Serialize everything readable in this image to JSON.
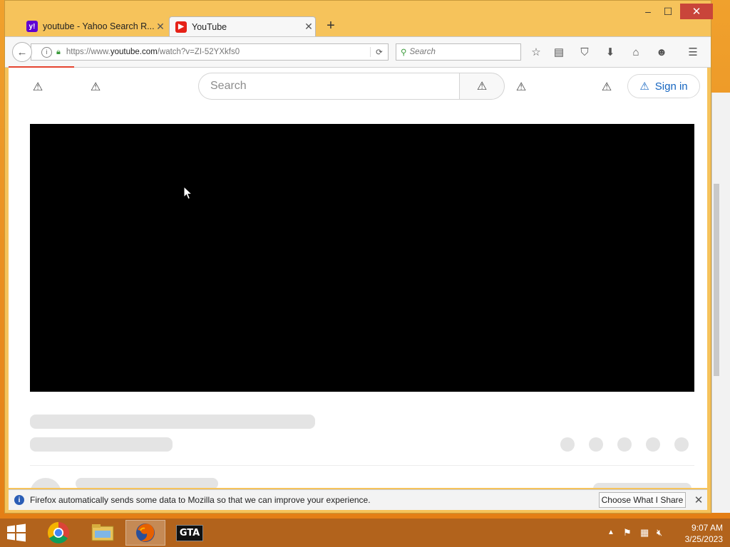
{
  "browser": {
    "tabs": [
      {
        "label": "youtube - Yahoo Search R...",
        "favicon": "yahoo-icon",
        "active": false
      },
      {
        "label": "YouTube",
        "favicon": "youtube-icon",
        "active": true
      }
    ],
    "window_controls": {
      "minimize": "–",
      "maximize": "☐",
      "close": "✕"
    },
    "url": {
      "prefix": "https://www.",
      "domain": "youtube.com",
      "path": "/watch?v=ZI-52YXkfs0"
    },
    "search_placeholder": "Search",
    "toolbar_icons": [
      "bookmark-star-icon",
      "reading-list-icon",
      "pocket-icon",
      "download-icon",
      "home-icon",
      "chat-icon",
      "menu-icon"
    ]
  },
  "youtube": {
    "search_placeholder": "Search",
    "sign_in_label": "Sign in"
  },
  "notification": {
    "message": "Firefox automatically sends some data to Mozilla so that we can improve your experience.",
    "button_label": "Choose What I Share"
  },
  "taskbar": {
    "apps": [
      "chrome-icon",
      "file-explorer-icon",
      "firefox-icon",
      "gta-icon"
    ],
    "gta_label": "GTA",
    "time": "9:07 AM",
    "date": "3/25/2023"
  },
  "colors": {
    "window_frame": "#f6c35b",
    "close_button": "#c9453a",
    "taskbar": "#b2631c",
    "sign_in_accent": "#1565c0",
    "load_progress": "#e5442f"
  }
}
